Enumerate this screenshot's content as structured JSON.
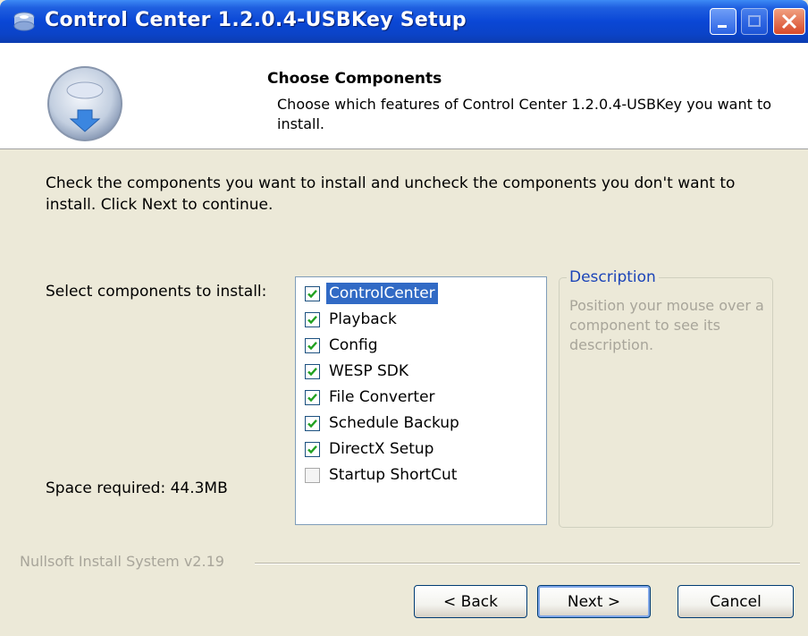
{
  "window": {
    "title": "Control Center 1.2.0.4-USBKey Setup",
    "controls": [
      "minimize-icon",
      "maximize-icon",
      "close-icon"
    ]
  },
  "header": {
    "title": "Choose Components",
    "subtitle": "Choose which features of Control Center 1.2.0.4-USBKey you want to install."
  },
  "instructions": "Check the components you want to install and uncheck the components you don't want to install. Click Next to continue.",
  "select_label": "Select components to install:",
  "space_required": "Space required: 44.3MB",
  "components": [
    {
      "label": "ControlCenter",
      "checked": true,
      "selected": true
    },
    {
      "label": "Playback",
      "checked": true,
      "selected": false
    },
    {
      "label": "Config",
      "checked": true,
      "selected": false
    },
    {
      "label": "WESP SDK",
      "checked": true,
      "selected": false
    },
    {
      "label": "File Converter",
      "checked": true,
      "selected": false
    },
    {
      "label": "Schedule Backup",
      "checked": true,
      "selected": false
    },
    {
      "label": "DirectX Setup",
      "checked": true,
      "selected": false
    },
    {
      "label": "Startup ShortCut",
      "checked": false,
      "selected": false
    }
  ],
  "description": {
    "title": "Description",
    "text": "Position your mouse over a component to see its description."
  },
  "branding": "Nullsoft Install System v2.19",
  "buttons": {
    "back": "< Back",
    "next": "Next >",
    "cancel": "Cancel"
  },
  "colors": {
    "titlebar": "#0a47d6",
    "dialog_bg": "#ece9d8",
    "selection": "#316ac5",
    "group_title": "#1b44b8",
    "checkmark": "#21a121"
  }
}
